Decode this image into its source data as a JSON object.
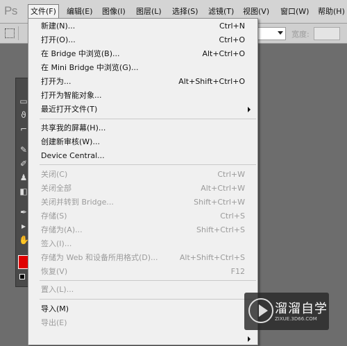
{
  "app": {
    "logo": "Ps"
  },
  "menubar": {
    "items": [
      {
        "label": "文件(F)"
      },
      {
        "label": "编辑(E)"
      },
      {
        "label": "图像(I)"
      },
      {
        "label": "图层(L)"
      },
      {
        "label": "选择(S)"
      },
      {
        "label": "滤镜(T)"
      },
      {
        "label": "视图(V)"
      },
      {
        "label": "窗口(W)"
      },
      {
        "label": "帮助(H)"
      }
    ]
  },
  "options_bar": {
    "width_label": "宽度:"
  },
  "file_menu": {
    "items": [
      {
        "label": "新建(N)...",
        "shortcut": "Ctrl+N"
      },
      {
        "label": "打开(O)...",
        "shortcut": "Ctrl+O"
      },
      {
        "label": "在 Bridge 中浏览(B)...",
        "shortcut": "Alt+Ctrl+O"
      },
      {
        "label": "在 Mini Bridge 中浏览(G)...",
        "shortcut": ""
      },
      {
        "label": "打开为...",
        "shortcut": "Alt+Shift+Ctrl+O"
      },
      {
        "label": "打开为智能对象...",
        "shortcut": ""
      },
      {
        "label": "最近打开文件(T)",
        "shortcut": ""
      },
      {
        "label": "共享我的屏幕(H)...",
        "shortcut": ""
      },
      {
        "label": "创建新审核(W)...",
        "shortcut": ""
      },
      {
        "label": "Device Central...",
        "shortcut": ""
      },
      {
        "label": "关闭(C)",
        "shortcut": "Ctrl+W"
      },
      {
        "label": "关闭全部",
        "shortcut": "Alt+Ctrl+W"
      },
      {
        "label": "关闭并转到 Bridge...",
        "shortcut": "Shift+Ctrl+W"
      },
      {
        "label": "存储(S)",
        "shortcut": "Ctrl+S"
      },
      {
        "label": "存储为(A)...",
        "shortcut": "Shift+Ctrl+S"
      },
      {
        "label": "签入(I)...",
        "shortcut": ""
      },
      {
        "label": "存储为 Web 和设备所用格式(D)...",
        "shortcut": "Alt+Shift+Ctrl+S"
      },
      {
        "label": "恢复(V)",
        "shortcut": "F12"
      },
      {
        "label": "置入(L)...",
        "shortcut": ""
      },
      {
        "label": "导入(M)",
        "shortcut": ""
      },
      {
        "label": "导出(E)",
        "shortcut": ""
      }
    ]
  },
  "watermark": {
    "title": "溜溜自学",
    "url": "ZIXUE.3D66.COM"
  },
  "colors": {
    "foreground_swatch": "#e00000",
    "menu_bg": "#f0f0f0",
    "disabled_text": "#9b9b9b"
  }
}
